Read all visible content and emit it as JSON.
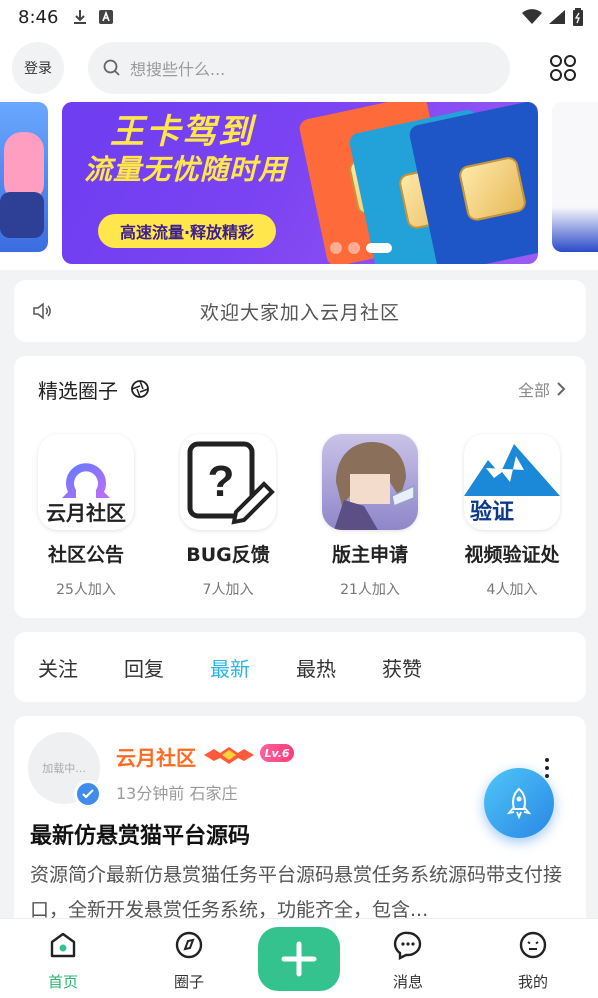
{
  "status_bar": {
    "time": "8:46"
  },
  "header": {
    "login_label": "登录",
    "search_placeholder": "想搜些什么..."
  },
  "banner": {
    "title_top": "王卡驾到",
    "title": "流量无忧随时用",
    "pill_text": "高速流量·释放精彩",
    "active_slide": 3,
    "slide_count": 3,
    "colors": {
      "background": "#7b43f2",
      "headline": "#ffe74a",
      "pill": "#ffe64a"
    }
  },
  "notice": {
    "text": "欢迎大家加入云月社区"
  },
  "circles": {
    "title": "精选圈子",
    "all_label": "全部",
    "items": [
      {
        "name": "社区公告",
        "count": "25人加入",
        "img_text": "云月社区"
      },
      {
        "name": "BUG反馈",
        "count": "7人加入"
      },
      {
        "name": "版主申请",
        "count": "21人加入"
      },
      {
        "name": "视频验证处",
        "count": "4人加入",
        "img_text": "验证"
      }
    ]
  },
  "tabs": {
    "items": [
      "关注",
      "回复",
      "最新",
      "最热",
      "获赞"
    ],
    "active_index": 2,
    "active_color": "#29b6e8"
  },
  "post": {
    "avatar_text": "加载中...",
    "author": "云月社区",
    "level": "Lv.6",
    "meta": "13分钟前 石家庄",
    "title": "最新仿悬赏猫平台源码",
    "excerpt": "资源简介最新仿悬赏猫任务平台源码悬赏任务系统源码带支付接口，全新开发悬赏任务系统，功能齐全，包含..."
  },
  "bottom_nav": {
    "items": [
      {
        "label": "首页",
        "icon": "home-icon",
        "active": true
      },
      {
        "label": "圈子",
        "icon": "compass-icon",
        "active": false
      },
      {
        "label": "消息",
        "icon": "chat-icon",
        "active": false
      },
      {
        "label": "我的",
        "icon": "face-icon",
        "active": false
      }
    ],
    "active_color": "#2bb673",
    "add_color": "#34c38f"
  }
}
